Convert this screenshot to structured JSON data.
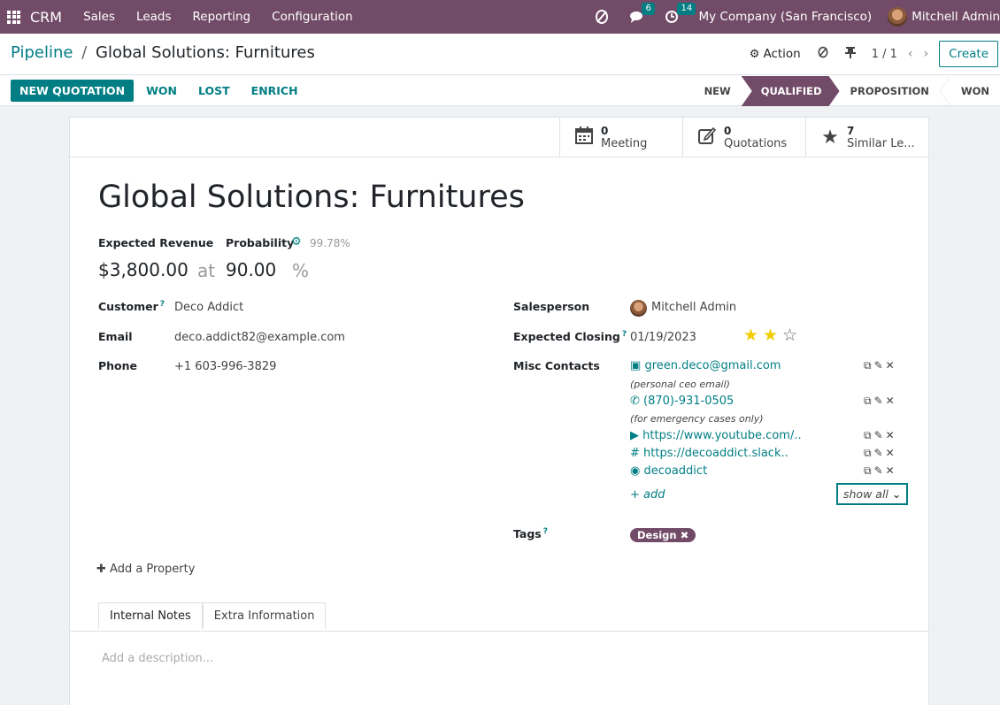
{
  "navbar": {
    "app_name": "CRM",
    "menus": [
      "Sales",
      "Leads",
      "Reporting",
      "Configuration"
    ],
    "messages_count": "6",
    "activities_count": "14",
    "company": "My Company (San Francisco)",
    "user": "Mitchell Admin",
    "bg_color": "#714b67"
  },
  "breadcrumb": {
    "parent": "Pipeline",
    "separator": "/",
    "current": "Global Solutions: Furnitures"
  },
  "control": {
    "action_label": "Action",
    "pager": "1 / 1",
    "create_label": "Create"
  },
  "buttons": {
    "new_quotation": "NEW QUOTATION",
    "won": "WON",
    "lost": "LOST",
    "enrich": "ENRICH"
  },
  "stages": {
    "items": [
      "NEW",
      "QUALIFIED",
      "PROPOSITION",
      "WON"
    ],
    "active": "QUALIFIED"
  },
  "smart_buttons": [
    {
      "value": "0",
      "label": "Meeting",
      "icon": "calendar-icon"
    },
    {
      "value": "0",
      "label": "Quotations",
      "icon": "edit-icon"
    },
    {
      "value": "7",
      "label": "Similar Le...",
      "icon": "star-icon"
    }
  ],
  "lead": {
    "title": "Global Solutions: Furnitures",
    "expected_revenue_label": "Expected Revenue",
    "probability_label": "Probability",
    "auto_probability": "99.78%",
    "expected_revenue": "$3,800.00",
    "at": "at",
    "probability": "90.00",
    "percent": "%",
    "customer_label": "Customer",
    "customer": "Deco Addict",
    "email_label": "Email",
    "email": "deco.addict82@example.com",
    "phone_label": "Phone",
    "phone": "+1 603-996-3829",
    "salesperson_label": "Salesperson",
    "salesperson": "Mitchell Admin",
    "closing_label": "Expected Closing",
    "closing": "01/19/2023",
    "priority_stars": 2,
    "priority_max": 3,
    "misc_label": "Misc Contacts",
    "misc": [
      {
        "icon": "envelope-icon",
        "text": "green.deco@gmail.com",
        "note": "(personal ceo email)"
      },
      {
        "icon": "phone-icon",
        "text": "(870)-931-0505",
        "note": "(for emergency cases only)"
      },
      {
        "icon": "youtube-icon",
        "text": "https://www.youtube.com/..",
        "note": ""
      },
      {
        "icon": "slack-icon",
        "text": "https://decoaddict.slack..",
        "note": ""
      },
      {
        "icon": "telegram-icon",
        "text": "decoaddict",
        "note": ""
      }
    ],
    "add_label": "add",
    "show_all_label": "show all",
    "tags_label": "Tags",
    "tag": "Design",
    "add_property": "Add a Property"
  },
  "tabs": [
    "Internal Notes",
    "Extra Information"
  ],
  "description_placeholder": "Add a description..."
}
